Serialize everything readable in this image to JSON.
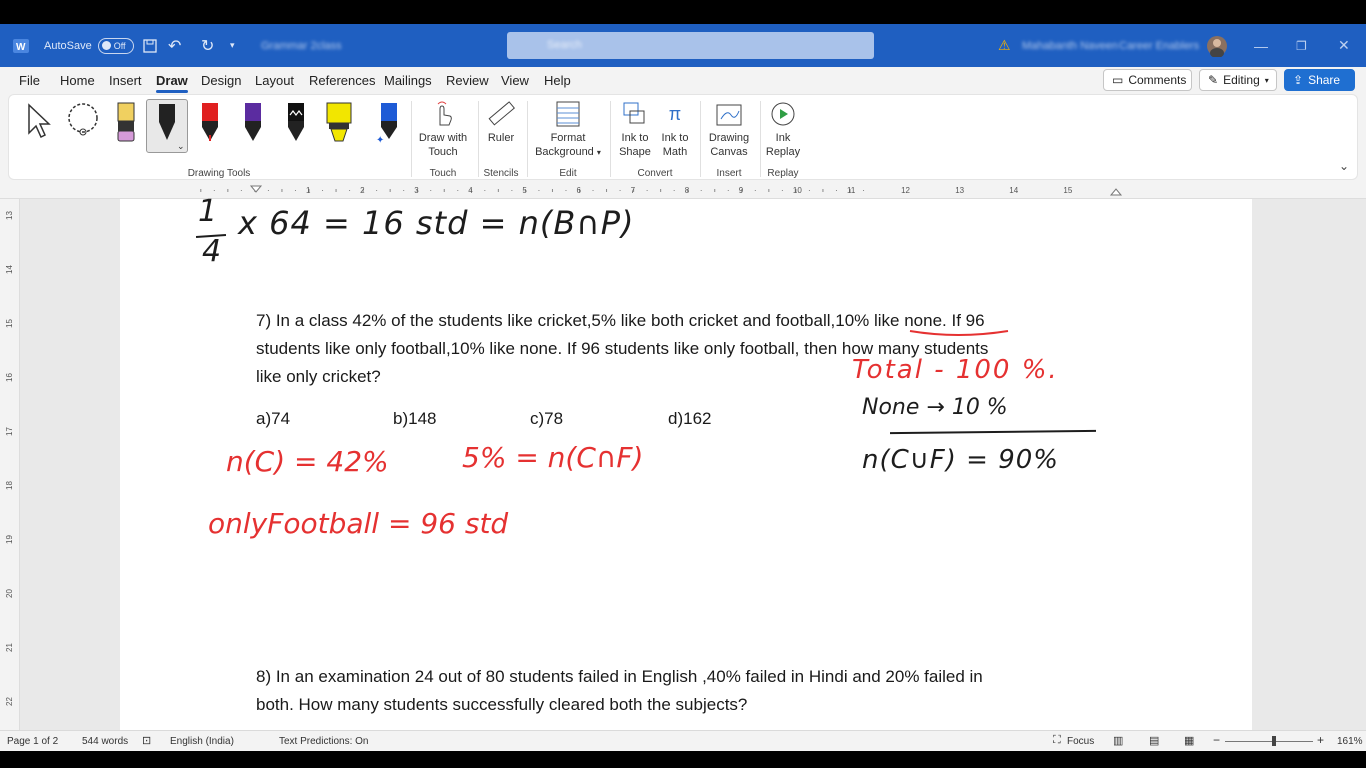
{
  "titlebar": {
    "autosave_label": "AutoSave",
    "autosave_state": "Off",
    "doc_name": "Grammar 2class",
    "search_placeholder": "Search",
    "user_name": "Mahabanth Naveen",
    "org_name": "Career Enablers"
  },
  "ribbon_tabs": [
    "File",
    "Home",
    "Insert",
    "Draw",
    "Design",
    "Layout",
    "References",
    "Mailings",
    "Review",
    "View",
    "Help"
  ],
  "active_tab": "Draw",
  "right_buttons": {
    "comments": "Comments",
    "editing": "Editing",
    "share": "Share"
  },
  "ribbon": {
    "groups": {
      "drawing_tools": "Drawing Tools",
      "touch": "Touch",
      "stencils": "Stencils",
      "edit": "Edit",
      "convert": "Convert",
      "insert": "Insert",
      "replay": "Replay"
    },
    "buttons": {
      "draw_with_touch": "Draw with Touch",
      "ruler": "Ruler",
      "format_background": "Format Background",
      "ink_to_shape": "Ink to Shape",
      "ink_to_math": "Ink to Math",
      "drawing_canvas": "Drawing Canvas",
      "ink_replay": "Ink Replay"
    },
    "pen_colors": [
      "#e8e8e8",
      "#111111",
      "#e02020",
      "#5b2ca0",
      "#111111",
      "#f2e600",
      "#1e5bd6"
    ]
  },
  "ruler": {
    "h_numbers": [
      "1",
      "2",
      "3",
      "4",
      "5",
      "6",
      "7",
      "8",
      "9",
      "10",
      "11",
      "12",
      "13",
      "14",
      "15"
    ],
    "v_numbers": [
      "13",
      "14",
      "15",
      "16",
      "17",
      "18",
      "19",
      "20",
      "21",
      "22"
    ]
  },
  "document": {
    "q7_line1": "7) In a class 42% of the students like cricket,5% like both cricket and football,10% like none. If 96",
    "q7_line2": "students like only football,10% like none. If 96 students like only football, then how many students",
    "q7_line3": "like only cricket?",
    "options": [
      "a)74",
      "b)148",
      "c)78",
      "d)162"
    ],
    "q8_line1": "8) In an examination 24 out of 80 students failed in English ,40% failed in Hindi and 20% failed in",
    "q8_line2": "both. How many students successfully cleared both the subjects?"
  },
  "ink": {
    "top_line_frac_num": "1",
    "top_line_frac_den": "4",
    "top_line_rest": "x 64 = 16 std = n(B∩P)",
    "red1": "n(C) = 42%",
    "red2": "5% = n(C∩F)",
    "red3": "onlyFootball = 96 std",
    "red4": "Total - 100 %.",
    "black1": "None → 10 %",
    "black2": "n(C∪F)   = 90%"
  },
  "statusbar": {
    "page": "Page 1 of 2",
    "words": "544 words",
    "language": "English (India)",
    "text_predictions": "Text Predictions: On",
    "focus": "Focus",
    "zoom": "161%"
  },
  "colors": {
    "titlebar": "#1f5fc1",
    "ink_red": "#e53131"
  }
}
